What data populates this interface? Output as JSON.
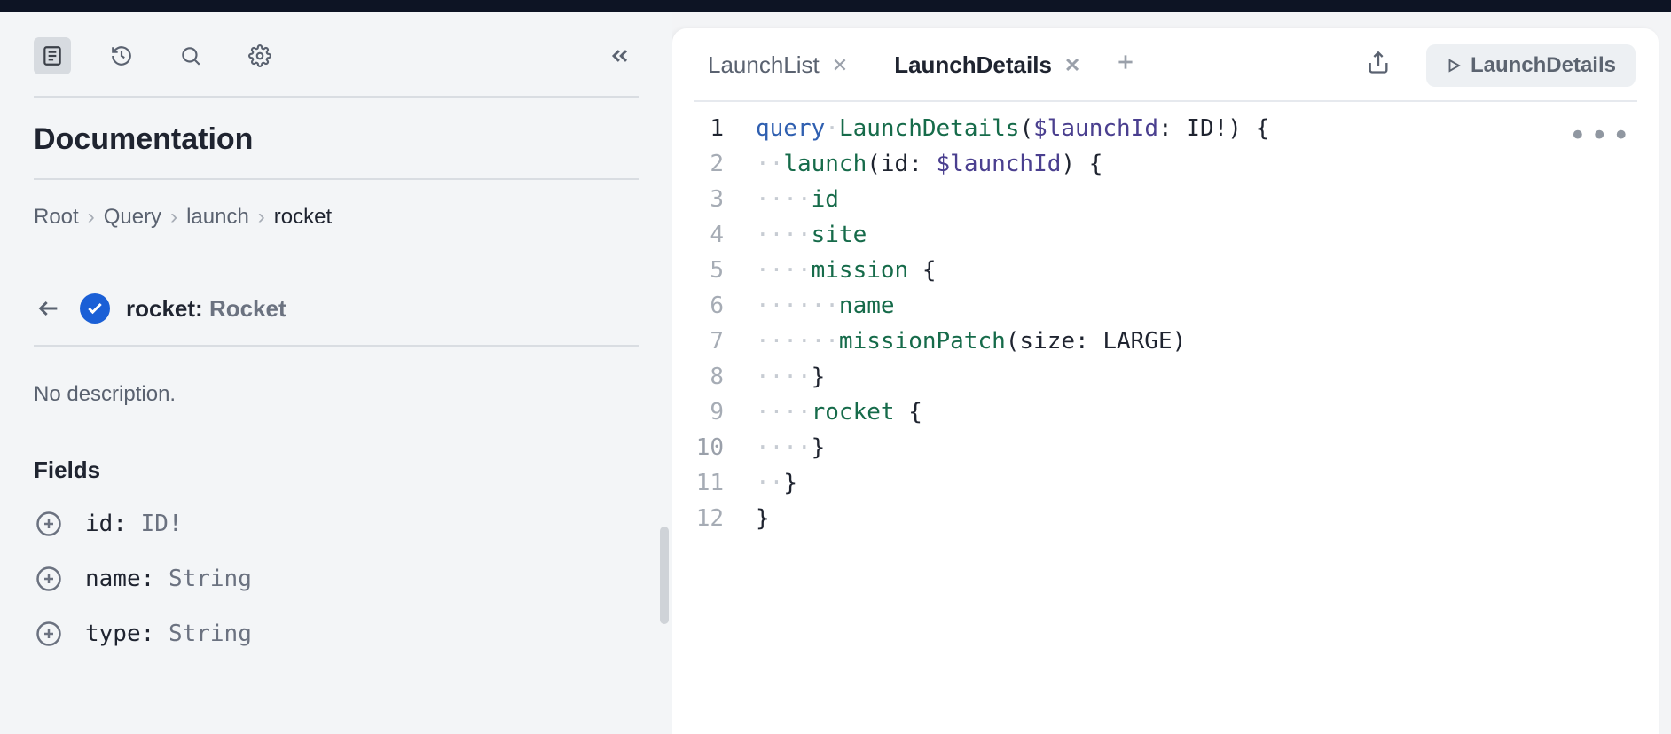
{
  "sidebar": {
    "title": "Documentation",
    "breadcrumb": [
      "Root",
      "Query",
      "launch",
      "rocket"
    ],
    "type": {
      "field": "rocket",
      "typename": "Rocket"
    },
    "description": "No description.",
    "fields_heading": "Fields",
    "fields": [
      {
        "name": "id",
        "type": "ID!"
      },
      {
        "name": "name",
        "type": "String"
      },
      {
        "name": "type",
        "type": "String"
      }
    ]
  },
  "editor": {
    "tabs": [
      {
        "label": "LaunchList",
        "active": false
      },
      {
        "label": "LaunchDetails",
        "active": true
      }
    ],
    "run_label": "LaunchDetails",
    "error_line": 10,
    "current_line": 1,
    "code_tokens": [
      [
        {
          "t": "kw",
          "v": "query"
        },
        {
          "t": "ws",
          "v": " "
        },
        {
          "t": "op",
          "v": "LaunchDetails"
        },
        {
          "t": "punc",
          "v": "("
        },
        {
          "t": "var",
          "v": "$launchId"
        },
        {
          "t": "punc",
          "v": ": "
        },
        {
          "t": "type",
          "v": "ID!"
        },
        {
          "t": "punc",
          "v": ") {"
        }
      ],
      [
        {
          "t": "ws",
          "v": "  "
        },
        {
          "t": "field",
          "v": "launch"
        },
        {
          "t": "punc",
          "v": "(id: "
        },
        {
          "t": "var",
          "v": "$launchId"
        },
        {
          "t": "punc",
          "v": ") {"
        }
      ],
      [
        {
          "t": "ws",
          "v": "    "
        },
        {
          "t": "field",
          "v": "id"
        }
      ],
      [
        {
          "t": "ws",
          "v": "    "
        },
        {
          "t": "field",
          "v": "site"
        }
      ],
      [
        {
          "t": "ws",
          "v": "    "
        },
        {
          "t": "field",
          "v": "mission"
        },
        {
          "t": "punc",
          "v": " {"
        }
      ],
      [
        {
          "t": "ws",
          "v": "      "
        },
        {
          "t": "field",
          "v": "name"
        }
      ],
      [
        {
          "t": "ws",
          "v": "      "
        },
        {
          "t": "field",
          "v": "missionPatch"
        },
        {
          "t": "punc",
          "v": "(size: "
        },
        {
          "t": "enum",
          "v": "LARGE"
        },
        {
          "t": "punc",
          "v": ")"
        }
      ],
      [
        {
          "t": "ws",
          "v": "    "
        },
        {
          "t": "punc",
          "v": "}"
        }
      ],
      [
        {
          "t": "ws",
          "v": "    "
        },
        {
          "t": "field",
          "v": "rocket"
        },
        {
          "t": "punc",
          "v": " {"
        }
      ],
      [
        {
          "t": "ws",
          "v": "    "
        },
        {
          "t": "punc",
          "v": "}"
        }
      ],
      [
        {
          "t": "ws",
          "v": "  "
        },
        {
          "t": "punc",
          "v": "}"
        }
      ],
      [
        {
          "t": "punc",
          "v": "}"
        }
      ]
    ],
    "selection_widths": [
      580,
      420,
      120,
      170,
      220,
      180,
      490,
      110,
      210,
      110,
      90,
      60
    ]
  }
}
